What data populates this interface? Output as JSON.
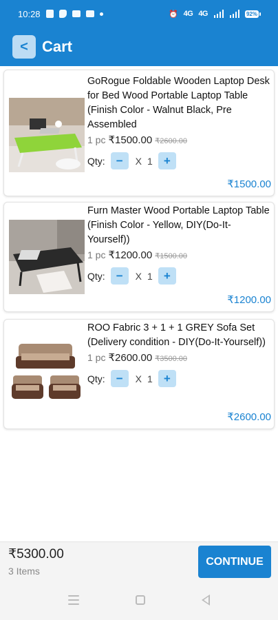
{
  "status_bar": {
    "time": "10:28",
    "left_icons": [
      "notes-icon",
      "phone-icon",
      "chat-icon",
      "gallery-icon",
      "dot-icon"
    ],
    "right_icons": [
      "alarm-icon",
      "volte-icon",
      "volte-icon",
      "wifi-signal-icon",
      "cell-signal-icon"
    ],
    "volte1": "4G",
    "volte2": "4G",
    "battery": "92%"
  },
  "app_bar": {
    "back_glyph": "<",
    "title": "Cart"
  },
  "cart_items": [
    {
      "title": "GoRogue Foldable Wooden Laptop Desk for Bed Wood Portable Laptop Table  (Finish Color - Walnut Black, Pre Assembled",
      "qty_label": "1 pc",
      "price": "₹1500.00",
      "mrp": "₹2600.00",
      "qty_text": "Qty:",
      "minus": "−",
      "x": "X",
      "quantity": "1",
      "plus": "+",
      "subtotal": "₹1500.00",
      "image": "laptop-desk-green"
    },
    {
      "title": "Furn Master Wood Portable Laptop Table  (Finish Color - Yellow, DIY(Do-It-Yourself))",
      "qty_label": "1 pc",
      "price": "₹1200.00",
      "mrp": "₹1500.00",
      "qty_text": "Qty:",
      "minus": "−",
      "x": "X",
      "quantity": "1",
      "plus": "+",
      "subtotal": "₹1200.00",
      "image": "laptop-table-black"
    },
    {
      "title": "ROO Fabric 3 + 1 + 1 GREY Sofa Set  (Delivery condition - DIY(Do-It-Yourself))",
      "qty_label": "1 pc",
      "price": "₹2600.00",
      "mrp": "₹3500.00",
      "qty_text": "Qty:",
      "minus": "−",
      "x": "X",
      "quantity": "1",
      "plus": "+",
      "subtotal": "₹2600.00",
      "image": "sofa-set-brown"
    }
  ],
  "footer": {
    "total": "₹5300.00",
    "items": "3 Items",
    "continue": "CONTINUE"
  },
  "colors": {
    "primary": "#1a83d1",
    "qty_button_bg": "#bfe0f6"
  }
}
